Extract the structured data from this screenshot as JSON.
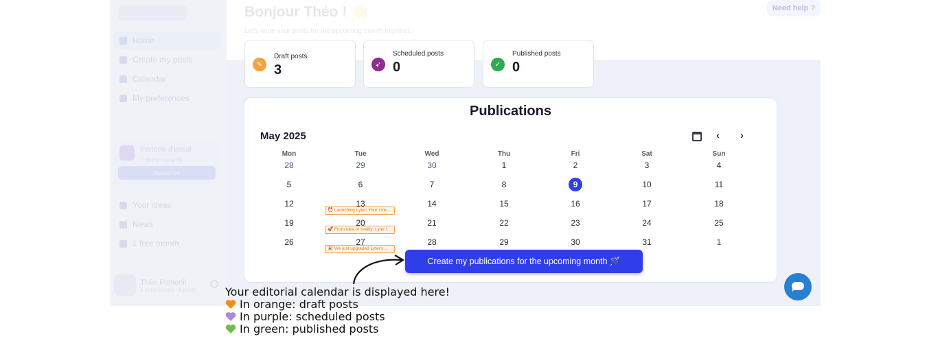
{
  "sidebar": {
    "items": [
      {
        "label": "Home",
        "icon": "home-icon"
      },
      {
        "label": "Create my posts",
        "icon": "edit-icon"
      },
      {
        "label": "Calendar",
        "icon": "calendar-icon"
      },
      {
        "label": "My preferences",
        "icon": "settings-icon"
      }
    ],
    "trial": {
      "title": "Période d'essai",
      "subtitle": "7 jours restants",
      "button": "Souscrire"
    },
    "secondary_items": [
      {
        "label": "Your ideas"
      },
      {
        "label": "News"
      },
      {
        "label": "1 free month"
      }
    ],
    "user": {
      "name": "Théo Fontenil",
      "subtitle": "4 publications · 4 posts"
    }
  },
  "header": {
    "greeting": "Bonjour Théo ! 👋",
    "subtitle": "Let's write your posts for the upcoming month together.",
    "help_button": "Need help ?"
  },
  "stats": [
    {
      "label": "Draft posts",
      "value": "3",
      "color": "#f5a33a",
      "icon": "pencil-icon"
    },
    {
      "label": "Scheduled posts",
      "value": "0",
      "color": "#8e2e8e",
      "icon": "rocket-icon"
    },
    {
      "label": "Published posts",
      "value": "0",
      "color": "#2eaa4f",
      "icon": "check-icon"
    }
  ],
  "calendar": {
    "title": "Publications",
    "month": "May 2025",
    "weekdays": [
      "Mon",
      "Tue",
      "Wed",
      "Thu",
      "Fri",
      "Sat",
      "Sun"
    ],
    "weeks": [
      [
        "28",
        "29",
        "30",
        "1",
        "2",
        "3",
        "4"
      ],
      [
        "5",
        "6",
        "7",
        "8",
        "9",
        "10",
        "11"
      ],
      [
        "12",
        "13",
        "14",
        "15",
        "16",
        "17",
        "18"
      ],
      [
        "19",
        "20",
        "21",
        "22",
        "23",
        "24",
        "25"
      ],
      [
        "26",
        "27",
        "28",
        "29",
        "30",
        "31",
        "1"
      ]
    ],
    "today": "9",
    "events": [
      {
        "day": "13",
        "text": "⏰ Launching Lyter: Your Link..."
      },
      {
        "day": "20",
        "text": "🚀 From idea to reality: Lyter i..."
      },
      {
        "day": "27",
        "text": "🎉 We just upgraded Lyter's ..."
      }
    ],
    "cta": "Create my publications for the upcoming month 🪄"
  },
  "annotation": {
    "line1": "Your editorial calendar is displayed here!",
    "line2": "In orange: draft posts",
    "line3": "In purple: scheduled posts",
    "line4": "In green: published posts",
    "colors": {
      "orange": "#f28c1a",
      "purple": "#a78bd6",
      "green": "#6cc04a"
    }
  }
}
